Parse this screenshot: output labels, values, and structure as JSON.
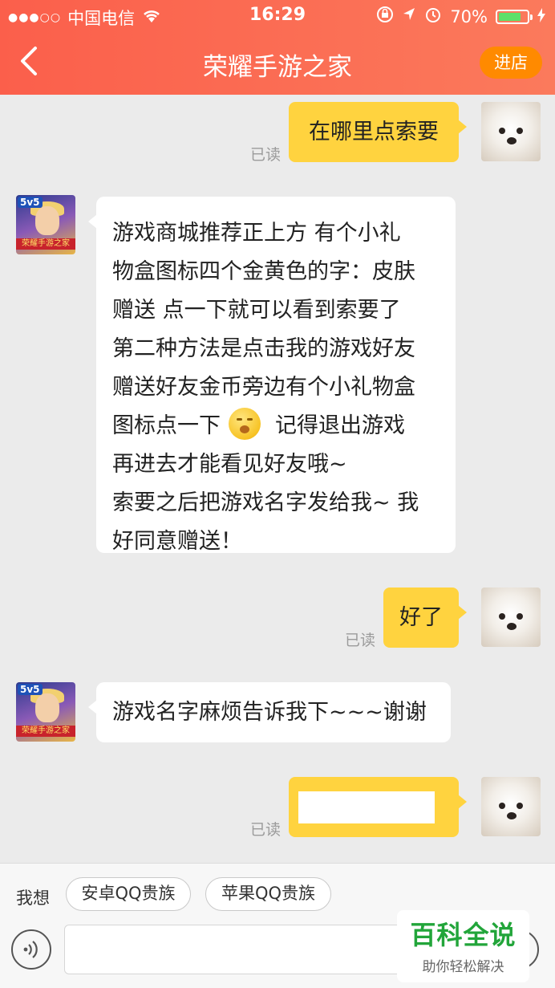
{
  "status_bar": {
    "signal": "●●●○○",
    "carrier": "中国电信",
    "wifi_icon": "wifi-icon",
    "time": "16:29",
    "battery": "70%"
  },
  "header": {
    "back_icon": "back-arrow-icon",
    "title": "荣耀手游之家",
    "enter_shop_label": "进店"
  },
  "messages": [
    {
      "direction": "out",
      "text": "在哪里点索要",
      "status": "已读"
    },
    {
      "direction": "in",
      "lines": [
        "游戏商城推荐正上方 有个小礼",
        "物盒图标四个金黄色的字：皮肤",
        "赠送 点一下就可以看到索要了",
        "第二种方法是点击我的游戏好友",
        "赠送好友金币旁边有个小礼物盒"
      ],
      "line6_before": "图标点一下",
      "line6_after": "记得退出游戏",
      "lines_tail": [
        "再进去才能看见好友哦~",
        "索要之后把游戏名字发给我~ 我",
        "好同意赠送！"
      ],
      "emoji": "yawning-face-emoji"
    },
    {
      "direction": "out",
      "text": "好了",
      "status": "已读"
    },
    {
      "direction": "in",
      "text": "游戏名字麻烦告诉我下~~~谢谢"
    },
    {
      "direction": "out",
      "text": "",
      "status": "已读"
    }
  ],
  "shop_avatar_tag": "5v5",
  "shop_avatar_ribbon": "荣耀手游之家",
  "bottom": {
    "want_label": "我想",
    "quick_replies": [
      "安卓QQ贵族",
      "苹果QQ贵族"
    ],
    "voice_icon": "voice-icon",
    "plus_icon": "plus-icon",
    "watermark_title": "百科全说",
    "watermark_sub": "助你轻松解决"
  }
}
